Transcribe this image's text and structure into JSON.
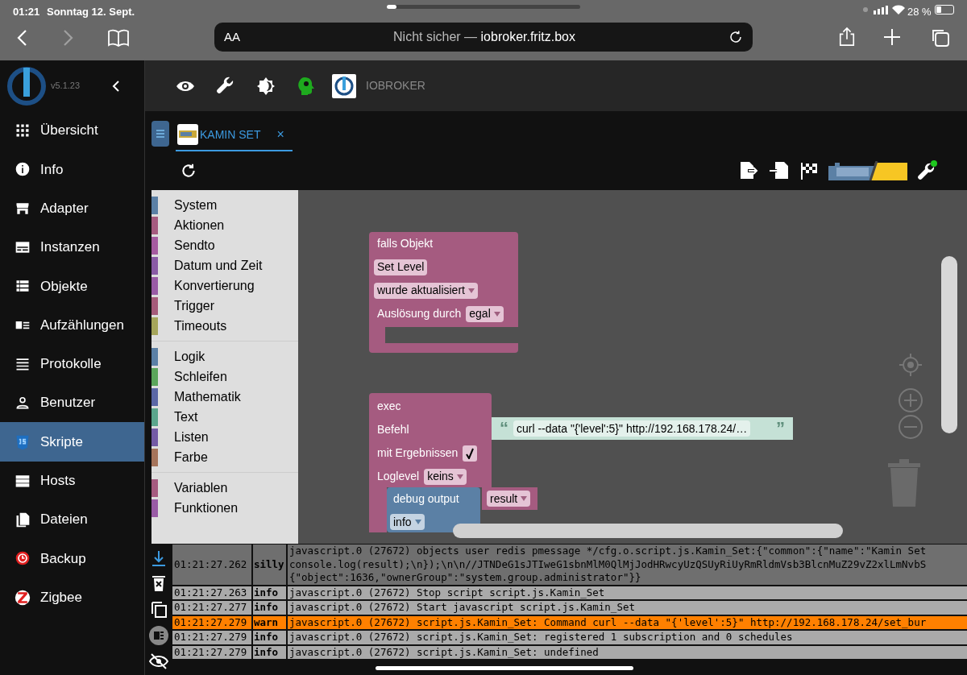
{
  "status_bar": {
    "time": "01:21",
    "date": "Sonntag 12. Sept.",
    "battery": "28 %"
  },
  "browser": {
    "reader_label": "AA",
    "security_label": "Nicht sicher —",
    "host": "iobroker.fritz.box"
  },
  "app": {
    "version": "v5.1.23",
    "title": "IOBROKER",
    "sidebar": [
      {
        "label": "Übersicht",
        "selected": false
      },
      {
        "label": "Info",
        "selected": false
      },
      {
        "label": "Adapter",
        "selected": false
      },
      {
        "label": "Instanzen",
        "selected": false
      },
      {
        "label": "Objekte",
        "selected": false
      },
      {
        "label": "Aufzählungen",
        "selected": false
      },
      {
        "label": "Protokolle",
        "selected": false
      },
      {
        "label": "Benutzer",
        "selected": false
      },
      {
        "label": "Skripte",
        "selected": true
      },
      {
        "label": "Hosts",
        "selected": false
      },
      {
        "label": "Dateien",
        "selected": false
      },
      {
        "label": "Backup",
        "selected": false
      },
      {
        "label": "Zigbee",
        "selected": false
      }
    ],
    "tabs": [
      {
        "label": "KAMIN SET",
        "selected": true,
        "close": "×"
      }
    ],
    "toolbox": [
      [
        {
          "label": "System",
          "color": "#5b80a5"
        },
        {
          "label": "Aktionen",
          "color": "#a55b80"
        },
        {
          "label": "Sendto",
          "color": "#a55ba0"
        },
        {
          "label": "Datum und Zeit",
          "color": "#8a5ba5"
        },
        {
          "label": "Konvertierung",
          "color": "#995ba5"
        },
        {
          "label": "Trigger",
          "color": "#a55b7a"
        },
        {
          "label": "Timeouts",
          "color": "#a5a55b"
        }
      ],
      [
        {
          "label": "Logik",
          "color": "#5b80a5"
        },
        {
          "label": "Schleifen",
          "color": "#5ba55b"
        },
        {
          "label": "Mathematik",
          "color": "#5b67a5"
        },
        {
          "label": "Text",
          "color": "#5ba58c"
        },
        {
          "label": "Listen",
          "color": "#745ba5"
        },
        {
          "label": "Farbe",
          "color": "#a5745b"
        }
      ],
      [
        {
          "label": "Variablen",
          "color": "#a55b80"
        },
        {
          "label": "Funktionen",
          "color": "#995ba5"
        }
      ]
    ],
    "trigger_block": {
      "title": "falls Objekt",
      "object": "Set Level",
      "event": "wurde aktualisiert",
      "source_label": "Auslösung durch",
      "source": "egal"
    },
    "exec_block": {
      "title": "exec",
      "command_label": "Befehl",
      "open_quote": "“",
      "command": "curl --data \"{'level':5}\" http://192.168.178.24/…",
      "close_quote": "”",
      "results_label": "mit Ergebnissen",
      "results_checked": true,
      "loglevel_label": "Loglevel",
      "loglevel": "keins"
    },
    "debug_block": {
      "title": "debug output",
      "value": "result",
      "level": "info"
    },
    "log": [
      {
        "time": "01:21:27.262",
        "level": "silly",
        "lines": [
          "javascript.0 (27672) objects user redis pmessage */cfg.o.script.js.Kamin_Set:{\"common\":{\"name\":\"Kamin Set",
          "console.log(result);\\n});\\n\\n//JTNDeG1sJTIweG1sbnMlM0QlMjJodHRwcyUzQSUyRiUyRmRldmVsb3BlcnMuZ29vZ2xlLmNvbS",
          "{\"object\":1636,\"ownerGroup\":\"system.group.administrator\"}}"
        ]
      },
      {
        "time": "01:21:27.263",
        "level": "info",
        "lines": [
          "javascript.0 (27672) Stop script script.js.Kamin_Set"
        ]
      },
      {
        "time": "01:21:27.277",
        "level": "info",
        "lines": [
          "javascript.0 (27672) Start javascript script.js.Kamin_Set"
        ]
      },
      {
        "time": "01:21:27.279",
        "level": "warn",
        "lines": [
          "javascript.0 (27672) script.js.Kamin_Set: Command curl --data \"{'level':5}\" http://192.168.178.24/set_bur"
        ]
      },
      {
        "time": "01:21:27.279",
        "level": "info",
        "lines": [
          "javascript.0 (27672) script.js.Kamin_Set: registered 1 subscription and 0 schedules"
        ]
      },
      {
        "time": "01:21:27.279",
        "level": "info",
        "lines": [
          "javascript.0 (27672) script.js.Kamin_Set: undefined"
        ]
      }
    ]
  }
}
